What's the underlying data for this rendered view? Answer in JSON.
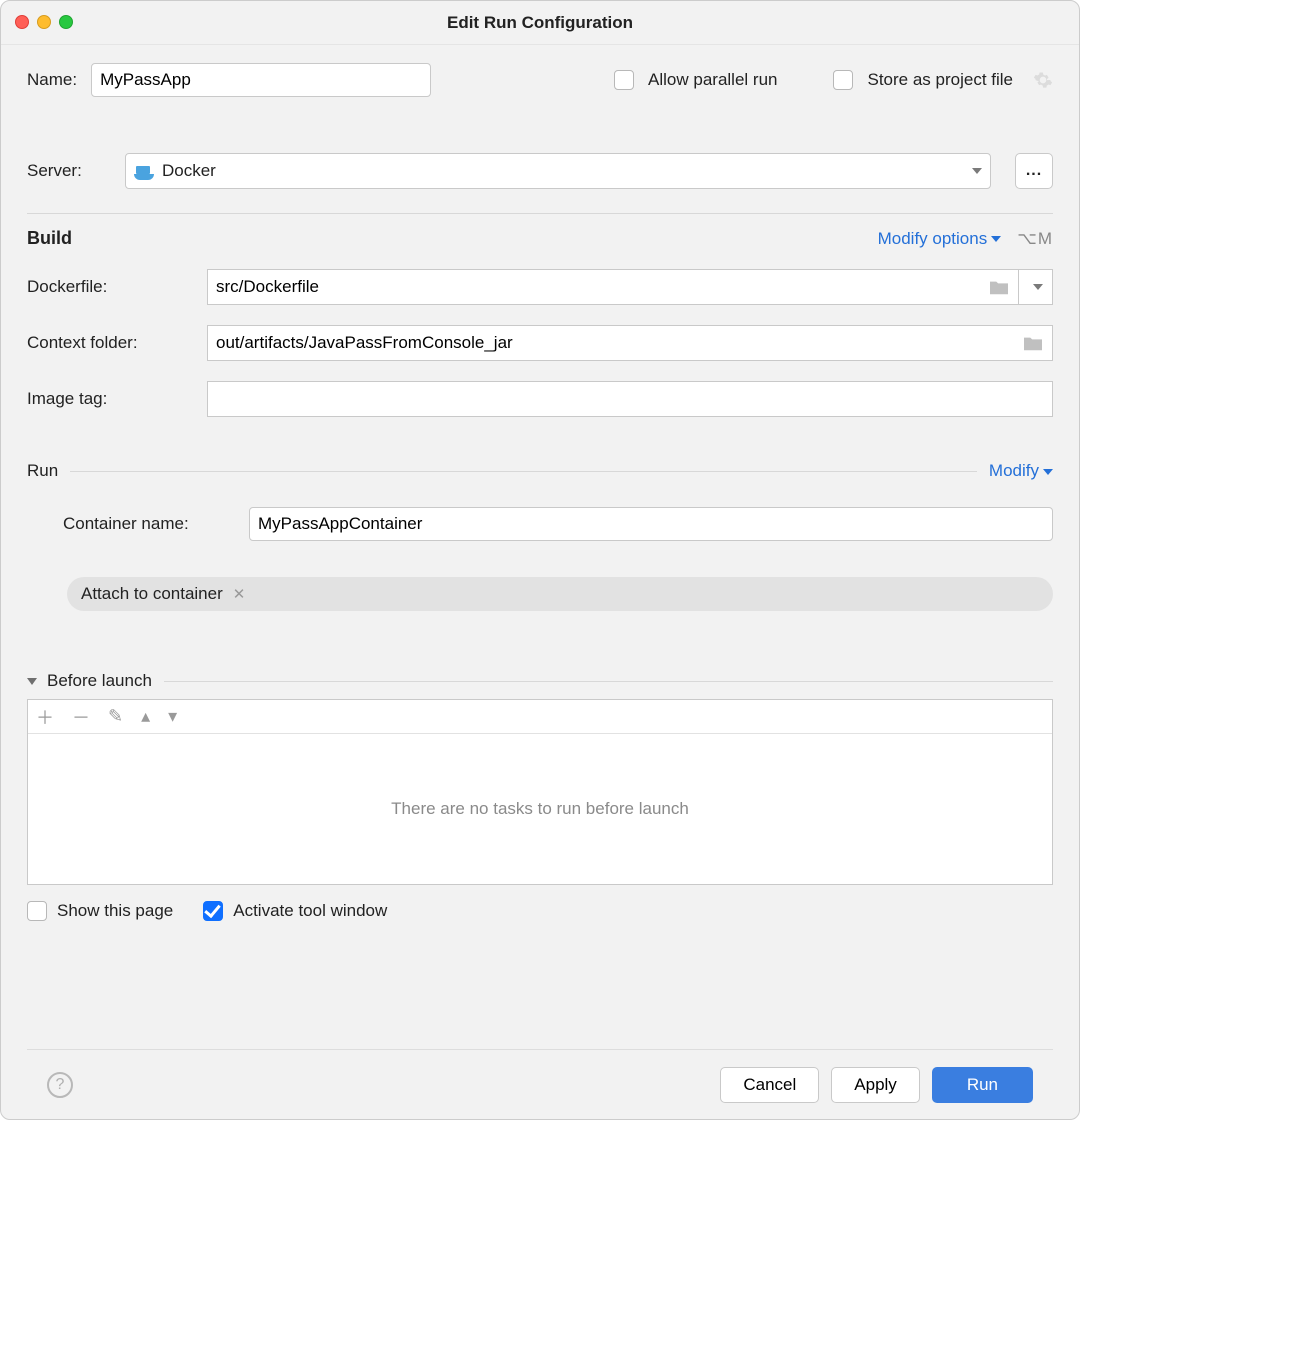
{
  "title": "Edit Run Configuration",
  "name_label": "Name:",
  "name_value": "MyPassApp",
  "allow_parallel_label": "Allow parallel run",
  "store_label": "Store as project file",
  "server_label": "Server:",
  "server_value": "Docker",
  "more_btn": "...",
  "build": {
    "title": "Build",
    "modify": "Modify options",
    "shortcut": "⌥M",
    "dockerfile_label": "Dockerfile:",
    "dockerfile_value": "src/Dockerfile",
    "context_label": "Context folder:",
    "context_value": "out/artifacts/JavaPassFromConsole_jar",
    "image_tag_label": "Image tag:",
    "image_tag_value": ""
  },
  "run": {
    "title": "Run",
    "modify": "Modify",
    "container_label": "Container name:",
    "container_value": "MyPassAppContainer",
    "attach_tag": "Attach to container"
  },
  "before": {
    "title": "Before launch",
    "empty": "There are no tasks to run before launch"
  },
  "show_page": "Show this page",
  "activate_tool": "Activate tool window",
  "cancel": "Cancel",
  "apply": "Apply",
  "run_btn": "Run"
}
